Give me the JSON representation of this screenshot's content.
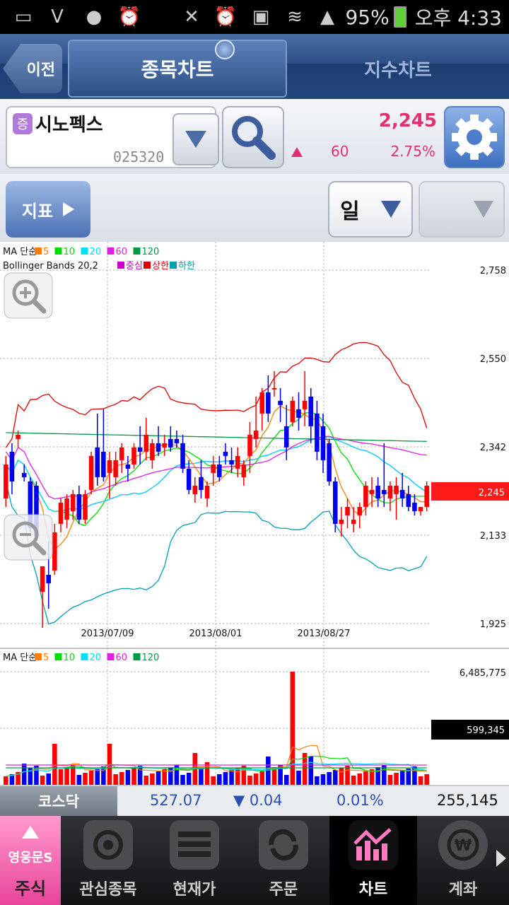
{
  "status_bar": {
    "battery": "95%",
    "time": "오후 4:33"
  },
  "nav": {
    "back_label": "이전",
    "tab_stock": "종목차트",
    "tab_index": "지수차트"
  },
  "stock": {
    "badge": "증",
    "name": "시노펙스",
    "code": "025320",
    "price": "2,245",
    "change": "60",
    "change_pct": "2.75%",
    "direction": "up"
  },
  "toolbar": {
    "indicator_label": "지표",
    "period": "일",
    "period2": ""
  },
  "legends": {
    "ma_label": "MA 단순",
    "ma_items": [
      {
        "label": "5",
        "color": "#ff8000"
      },
      {
        "label": "10",
        "color": "#00dd00"
      },
      {
        "label": "20",
        "color": "#00e0ff"
      },
      {
        "label": "60",
        "color": "#e020e0"
      },
      {
        "label": "120",
        "color": "#009944"
      }
    ],
    "bb_label": "Bollinger Bands 20,2",
    "bb_items": [
      {
        "label": "중심",
        "color": "#cc00cc"
      },
      {
        "label": "상한",
        "color": "#dd0000"
      },
      {
        "label": "하한",
        "color": "#00a0b0"
      }
    ]
  },
  "chart_data": [
    {
      "type": "candlestick",
      "title": "",
      "yticks": [
        "2,758",
        "2,550",
        "2,342",
        "2,133",
        "1,925"
      ],
      "ylim": [
        1925,
        2758
      ],
      "xticks": [
        "2013/07/09",
        "2013/08/01",
        "2013/08/27"
      ],
      "current_price_label": "2,245",
      "grid": true,
      "candles": [
        [
          2220,
          2320,
          2200,
          2300
        ],
        [
          2330,
          2350,
          2230,
          2260
        ],
        [
          2360,
          2380,
          2340,
          2370
        ],
        [
          2280,
          2300,
          2260,
          2270
        ],
        [
          2260,
          2270,
          2140,
          2150
        ],
        [
          2250,
          2260,
          2120,
          2130
        ],
        [
          2000,
          2030,
          1915,
          2060
        ],
        [
          2040,
          2120,
          1960,
          2020
        ],
        [
          2050,
          2160,
          2040,
          2140
        ],
        [
          2160,
          2220,
          2140,
          2210
        ],
        [
          2170,
          2230,
          2150,
          2220
        ],
        [
          2190,
          2240,
          2170,
          2230
        ],
        [
          2230,
          2250,
          2160,
          2170
        ],
        [
          2170,
          2240,
          2160,
          2230
        ],
        [
          2240,
          2330,
          2230,
          2320
        ],
        [
          2340,
          2420,
          2250,
          2270
        ],
        [
          2330,
          2430,
          2260,
          2270
        ],
        [
          2280,
          2330,
          2220,
          2310
        ],
        [
          2270,
          2330,
          2250,
          2310
        ],
        [
          2310,
          2350,
          2280,
          2340
        ],
        [
          2300,
          2320,
          2260,
          2290
        ],
        [
          2300,
          2350,
          2290,
          2340
        ],
        [
          2340,
          2390,
          2300,
          2330
        ],
        [
          2330,
          2410,
          2310,
          2370
        ],
        [
          2310,
          2360,
          2290,
          2350
        ],
        [
          2350,
          2390,
          2320,
          2330
        ],
        [
          2340,
          2370,
          2320,
          2350
        ],
        [
          2360,
          2390,
          2330,
          2340
        ],
        [
          2360,
          2380,
          2340,
          2350
        ],
        [
          2350,
          2370,
          2280,
          2290
        ],
        [
          2290,
          2310,
          2230,
          2240
        ],
        [
          2230,
          2270,
          2210,
          2250
        ],
        [
          2270,
          2310,
          2220,
          2240
        ],
        [
          2220,
          2260,
          2200,
          2250
        ],
        [
          2280,
          2320,
          2250,
          2300
        ],
        [
          2300,
          2320,
          2260,
          2270
        ],
        [
          2330,
          2350,
          2300,
          2320
        ],
        [
          2310,
          2340,
          2280,
          2300
        ],
        [
          2290,
          2340,
          2270,
          2320
        ],
        [
          2270,
          2310,
          2250,
          2300
        ],
        [
          2320,
          2400,
          2280,
          2370
        ],
        [
          2360,
          2460,
          2340,
          2380
        ],
        [
          2420,
          2480,
          2380,
          2470
        ],
        [
          2470,
          2510,
          2400,
          2420
        ],
        [
          2480,
          2520,
          2460,
          2480
        ],
        [
          2450,
          2480,
          2400,
          2440
        ],
        [
          2390,
          2440,
          2310,
          2340
        ],
        [
          2400,
          2460,
          2390,
          2450
        ],
        [
          2430,
          2470,
          2380,
          2410
        ],
        [
          2430,
          2520,
          2390,
          2450
        ],
        [
          2460,
          2480,
          2350,
          2390
        ],
        [
          2420,
          2450,
          2310,
          2330
        ],
        [
          2390,
          2420,
          2280,
          2310
        ],
        [
          2350,
          2360,
          2250,
          2260
        ],
        [
          2260,
          2270,
          2140,
          2160
        ],
        [
          2160,
          2200,
          2130,
          2170
        ],
        [
          2180,
          2220,
          2150,
          2200
        ],
        [
          2160,
          2200,
          2140,
          2170
        ],
        [
          2180,
          2210,
          2150,
          2200
        ],
        [
          2200,
          2260,
          2180,
          2250
        ],
        [
          2230,
          2270,
          2200,
          2240
        ],
        [
          2250,
          2270,
          2200,
          2220
        ],
        [
          2240,
          2350,
          2200,
          2230
        ],
        [
          2220,
          2260,
          2190,
          2250
        ],
        [
          2230,
          2270,
          2170,
          2250
        ],
        [
          2240,
          2280,
          2200,
          2220
        ],
        [
          2230,
          2250,
          2190,
          2200
        ],
        [
          2210,
          2230,
          2180,
          2190
        ],
        [
          2190,
          2200,
          2180,
          2200
        ],
        [
          2200,
          2260,
          2190,
          2250
        ]
      ]
    },
    {
      "type": "bar",
      "title": "",
      "yticks": [
        "6,485,775"
      ],
      "current_volume_label": "599,345"
    }
  ],
  "index_bar": {
    "name": "코스닥",
    "value": "527.07",
    "change": "▼ 0.04",
    "pct": "0.01%",
    "volume": "255,145"
  },
  "bottom_nav": [
    {
      "top": "영웅문S",
      "label": "주식"
    },
    {
      "label": "관심종목"
    },
    {
      "label": "현재가"
    },
    {
      "label": "주문"
    },
    {
      "label": "차트"
    },
    {
      "label": "계좌"
    }
  ]
}
